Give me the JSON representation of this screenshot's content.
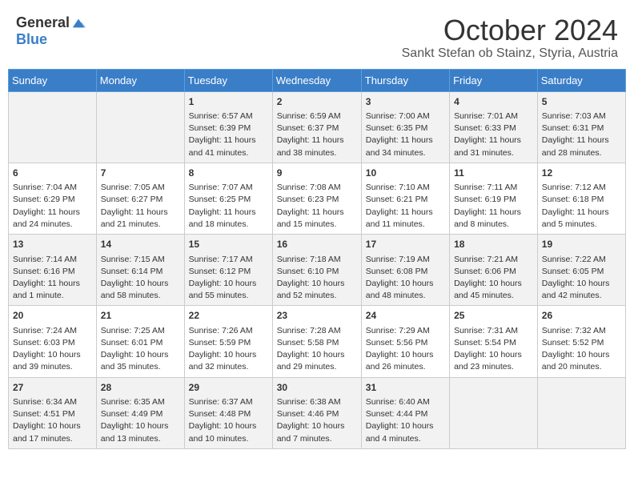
{
  "header": {
    "logo_general": "General",
    "logo_blue": "Blue",
    "month_title": "October 2024",
    "subtitle": "Sankt Stefan ob Stainz, Styria, Austria"
  },
  "weekdays": [
    "Sunday",
    "Monday",
    "Tuesday",
    "Wednesday",
    "Thursday",
    "Friday",
    "Saturday"
  ],
  "weeks": [
    [
      {
        "day": "",
        "info": ""
      },
      {
        "day": "",
        "info": ""
      },
      {
        "day": "1",
        "info": "Sunrise: 6:57 AM\nSunset: 6:39 PM\nDaylight: 11 hours and 41 minutes."
      },
      {
        "day": "2",
        "info": "Sunrise: 6:59 AM\nSunset: 6:37 PM\nDaylight: 11 hours and 38 minutes."
      },
      {
        "day": "3",
        "info": "Sunrise: 7:00 AM\nSunset: 6:35 PM\nDaylight: 11 hours and 34 minutes."
      },
      {
        "day": "4",
        "info": "Sunrise: 7:01 AM\nSunset: 6:33 PM\nDaylight: 11 hours and 31 minutes."
      },
      {
        "day": "5",
        "info": "Sunrise: 7:03 AM\nSunset: 6:31 PM\nDaylight: 11 hours and 28 minutes."
      }
    ],
    [
      {
        "day": "6",
        "info": "Sunrise: 7:04 AM\nSunset: 6:29 PM\nDaylight: 11 hours and 24 minutes."
      },
      {
        "day": "7",
        "info": "Sunrise: 7:05 AM\nSunset: 6:27 PM\nDaylight: 11 hours and 21 minutes."
      },
      {
        "day": "8",
        "info": "Sunrise: 7:07 AM\nSunset: 6:25 PM\nDaylight: 11 hours and 18 minutes."
      },
      {
        "day": "9",
        "info": "Sunrise: 7:08 AM\nSunset: 6:23 PM\nDaylight: 11 hours and 15 minutes."
      },
      {
        "day": "10",
        "info": "Sunrise: 7:10 AM\nSunset: 6:21 PM\nDaylight: 11 hours and 11 minutes."
      },
      {
        "day": "11",
        "info": "Sunrise: 7:11 AM\nSunset: 6:19 PM\nDaylight: 11 hours and 8 minutes."
      },
      {
        "day": "12",
        "info": "Sunrise: 7:12 AM\nSunset: 6:18 PM\nDaylight: 11 hours and 5 minutes."
      }
    ],
    [
      {
        "day": "13",
        "info": "Sunrise: 7:14 AM\nSunset: 6:16 PM\nDaylight: 11 hours and 1 minute."
      },
      {
        "day": "14",
        "info": "Sunrise: 7:15 AM\nSunset: 6:14 PM\nDaylight: 10 hours and 58 minutes."
      },
      {
        "day": "15",
        "info": "Sunrise: 7:17 AM\nSunset: 6:12 PM\nDaylight: 10 hours and 55 minutes."
      },
      {
        "day": "16",
        "info": "Sunrise: 7:18 AM\nSunset: 6:10 PM\nDaylight: 10 hours and 52 minutes."
      },
      {
        "day": "17",
        "info": "Sunrise: 7:19 AM\nSunset: 6:08 PM\nDaylight: 10 hours and 48 minutes."
      },
      {
        "day": "18",
        "info": "Sunrise: 7:21 AM\nSunset: 6:06 PM\nDaylight: 10 hours and 45 minutes."
      },
      {
        "day": "19",
        "info": "Sunrise: 7:22 AM\nSunset: 6:05 PM\nDaylight: 10 hours and 42 minutes."
      }
    ],
    [
      {
        "day": "20",
        "info": "Sunrise: 7:24 AM\nSunset: 6:03 PM\nDaylight: 10 hours and 39 minutes."
      },
      {
        "day": "21",
        "info": "Sunrise: 7:25 AM\nSunset: 6:01 PM\nDaylight: 10 hours and 35 minutes."
      },
      {
        "day": "22",
        "info": "Sunrise: 7:26 AM\nSunset: 5:59 PM\nDaylight: 10 hours and 32 minutes."
      },
      {
        "day": "23",
        "info": "Sunrise: 7:28 AM\nSunset: 5:58 PM\nDaylight: 10 hours and 29 minutes."
      },
      {
        "day": "24",
        "info": "Sunrise: 7:29 AM\nSunset: 5:56 PM\nDaylight: 10 hours and 26 minutes."
      },
      {
        "day": "25",
        "info": "Sunrise: 7:31 AM\nSunset: 5:54 PM\nDaylight: 10 hours and 23 minutes."
      },
      {
        "day": "26",
        "info": "Sunrise: 7:32 AM\nSunset: 5:52 PM\nDaylight: 10 hours and 20 minutes."
      }
    ],
    [
      {
        "day": "27",
        "info": "Sunrise: 6:34 AM\nSunset: 4:51 PM\nDaylight: 10 hours and 17 minutes."
      },
      {
        "day": "28",
        "info": "Sunrise: 6:35 AM\nSunset: 4:49 PM\nDaylight: 10 hours and 13 minutes."
      },
      {
        "day": "29",
        "info": "Sunrise: 6:37 AM\nSunset: 4:48 PM\nDaylight: 10 hours and 10 minutes."
      },
      {
        "day": "30",
        "info": "Sunrise: 6:38 AM\nSunset: 4:46 PM\nDaylight: 10 hours and 7 minutes."
      },
      {
        "day": "31",
        "info": "Sunrise: 6:40 AM\nSunset: 4:44 PM\nDaylight: 10 hours and 4 minutes."
      },
      {
        "day": "",
        "info": ""
      },
      {
        "day": "",
        "info": ""
      }
    ]
  ]
}
